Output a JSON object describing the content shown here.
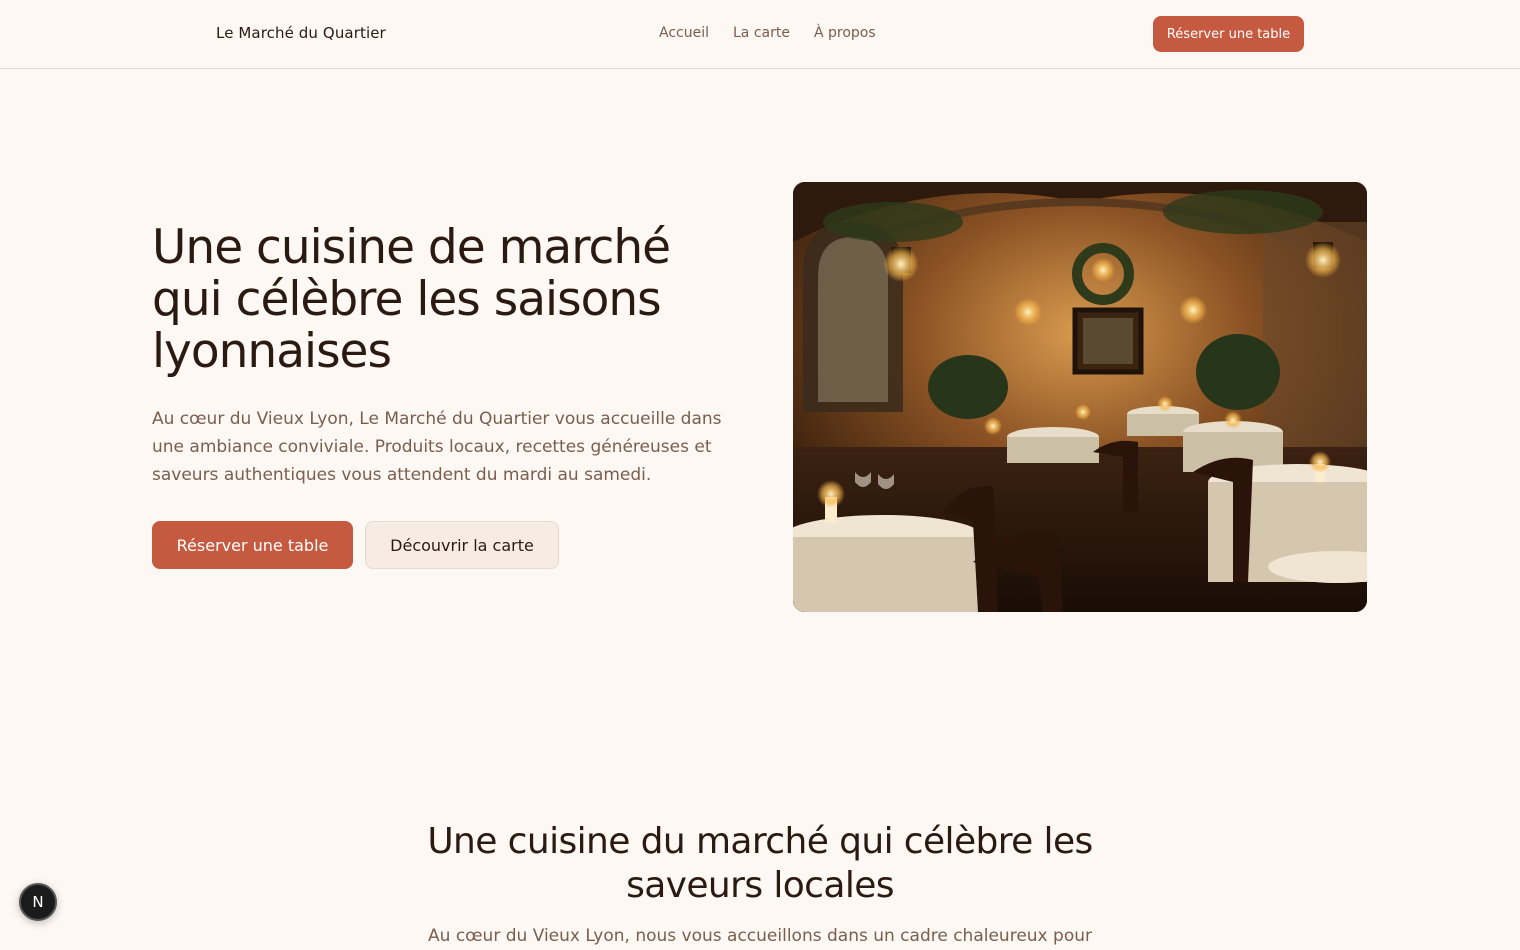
{
  "header": {
    "brand": "Le Marché du Quartier",
    "nav": [
      "Accueil",
      "La carte",
      "À propos"
    ],
    "cta_label": "Réserver une table"
  },
  "hero": {
    "title": "Une cuisine de marché qui célèbre les saisons lyonnaises",
    "text": "Au cœur du Vieux Lyon, Le Marché du Quartier vous accueille dans une ambiance conviviale. Produits locaux, recettes généreuses et saveurs authentiques vous attendent du mardi au samedi.",
    "primary_button": "Réserver une table",
    "secondary_button": "Découvrir la carte"
  },
  "section": {
    "title": "Une cuisine du marché qui célèbre les saveurs locales",
    "text": "Au cœur du Vieux Lyon, nous vous accueillons dans un cadre chaleureux pour"
  },
  "dev_badge": {
    "letter": "N"
  },
  "colors": {
    "accent": "#c65a40",
    "background": "#fdf8f4",
    "text_primary": "#2b1a12",
    "text_muted": "#7a5e4e"
  }
}
